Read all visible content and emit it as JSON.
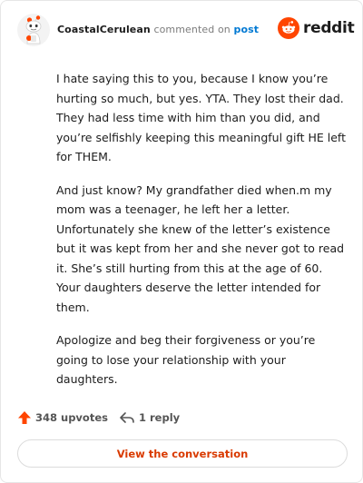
{
  "header": {
    "username": "CoastalCerulean",
    "commented_text": "commented on",
    "post_link": "post",
    "brand_name": "reddit"
  },
  "comment": {
    "paragraphs": [
      "I hate saying this to you, because I know you’re hurting so much, but yes. YTA. They lost their dad. They had less time with him than you did, and you’re selfishly keeping this meaningful gift HE left for THEM.",
      "And just know? My grandfather died when.m my mom was a teenager, he left her a letter. Unfortunately she knew of the letter’s existence but it was kept from her and she never got to read it. She’s still hurting from this at the age of 60. Your daughters deserve the letter intended for them.",
      "Apologize and beg their forgiveness or you’re going to lose your relationship with your daughters."
    ]
  },
  "actions": {
    "upvotes": "348 upvotes",
    "replies": "1 reply"
  },
  "view_button": "View the conversation",
  "colors": {
    "brand": "#ff4500",
    "link": "#0079d3",
    "button_text": "#d93a00"
  },
  "icons": [
    "avatar-snoo",
    "reddit-logo-icon",
    "upvote-arrow-icon",
    "reply-arrow-icon"
  ]
}
